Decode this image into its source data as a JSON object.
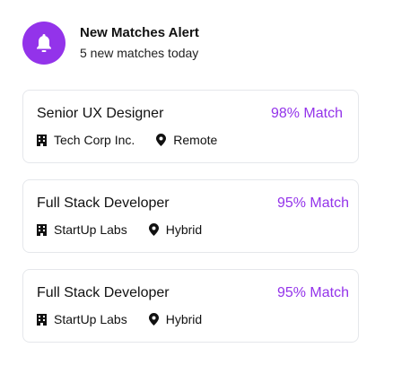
{
  "header": {
    "title": "New Matches Alert",
    "subtitle": "5 new matches today",
    "icon": "bell-icon",
    "accent": "#9333ea"
  },
  "jobs": [
    {
      "title": "Senior UX Designer",
      "match": "98% Match",
      "company": "Tech Corp Inc.",
      "location": "Remote"
    },
    {
      "title": "Full Stack Developer",
      "match": "95% Match",
      "company": "StartUp Labs",
      "location": "Hybrid"
    },
    {
      "title": "Full Stack Developer",
      "match": "95% Match",
      "company": "StartUp Labs",
      "location": "Hybrid"
    }
  ]
}
